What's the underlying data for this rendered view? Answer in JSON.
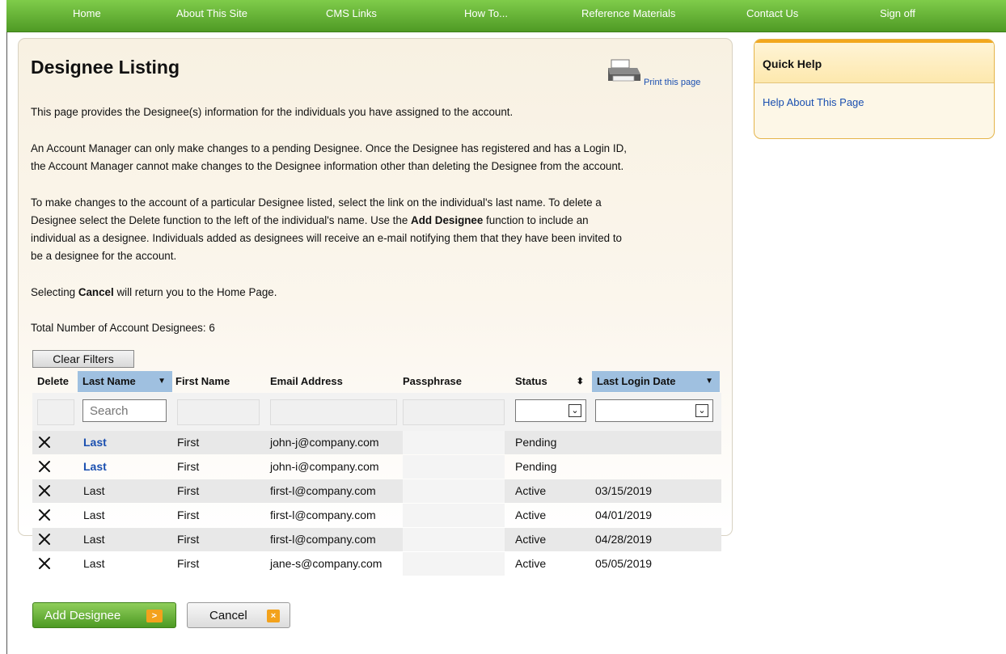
{
  "nav": {
    "items": [
      {
        "label": "Home"
      },
      {
        "label": "About This Site"
      },
      {
        "label": "CMS Links"
      },
      {
        "label": "How To..."
      },
      {
        "label": "Reference Materials"
      },
      {
        "label": "Contact Us"
      },
      {
        "label": "Sign off"
      }
    ]
  },
  "page": {
    "title": "Designee Listing",
    "print_label": "Print this page",
    "intro": "This page provides the Designee(s) information for the individuals you have assigned to the account.",
    "p2_line1": "An Account Manager can only make changes to a pending Designee. Once the Designee has registered and has a Login ID,",
    "p2_line2": "the Account Manager cannot make changes to the Designee information other than deleting the Designee from the account.",
    "p3_line1": "To make changes to the account of a particular Designee listed, select the link on the individual's last name. To delete a",
    "p3_line2": "Designee select the Delete function to the left of the individual's name. Use the ",
    "p3_bold": "Add Designee",
    "p3_line2_end": " function to include an",
    "p3_line3": "individual as a designee. Individuals added as designees will receive an e-mail notifying them that they have been invited to",
    "p3_line4": "be a designee for the account.",
    "cancel_note_pre": "Selecting ",
    "cancel_note_bold": "Cancel",
    "cancel_note_post": " will return you to the Home Page.",
    "total_label": "Total Number of Account Designees: 6"
  },
  "quick_help": {
    "title": "Quick Help",
    "link": "Help About This Page"
  },
  "table": {
    "clear_filters": "Clear Filters",
    "columns": {
      "delete": "Delete",
      "last_name": "Last Name",
      "first_name": "First Name",
      "email": "Email Address",
      "passphrase": "Passphrase",
      "status": "Status",
      "last_login": "Last Login Date"
    },
    "search_placeholder": "Search",
    "rows": [
      {
        "last": "Last",
        "first": "First",
        "email": "john-j@company.com",
        "passphrase": "",
        "status": "Pending",
        "last_login": ""
      },
      {
        "last": "Last",
        "first": "First",
        "email": "john-i@company.com",
        "passphrase": "",
        "status": "Pending",
        "last_login": ""
      },
      {
        "last": "Last",
        "first": "First",
        "email": "first-l@company.com",
        "passphrase": "",
        "status": "Active",
        "last_login": "03/15/2019"
      },
      {
        "last": "Last",
        "first": "First",
        "email": "first-l@company.com",
        "passphrase": "",
        "status": "Active",
        "last_login": "04/01/2019"
      },
      {
        "last": "Last",
        "first": "First",
        "email": "first-l@company.com",
        "passphrase": "",
        "status": "Active",
        "last_login": "04/28/2019"
      },
      {
        "last": "Last",
        "first": "First",
        "email": "jane-s@company.com",
        "passphrase": "",
        "status": "Active",
        "last_login": "05/05/2019"
      }
    ]
  },
  "actions": {
    "add_label": "Add Designee",
    "cancel_label": "Cancel"
  }
}
